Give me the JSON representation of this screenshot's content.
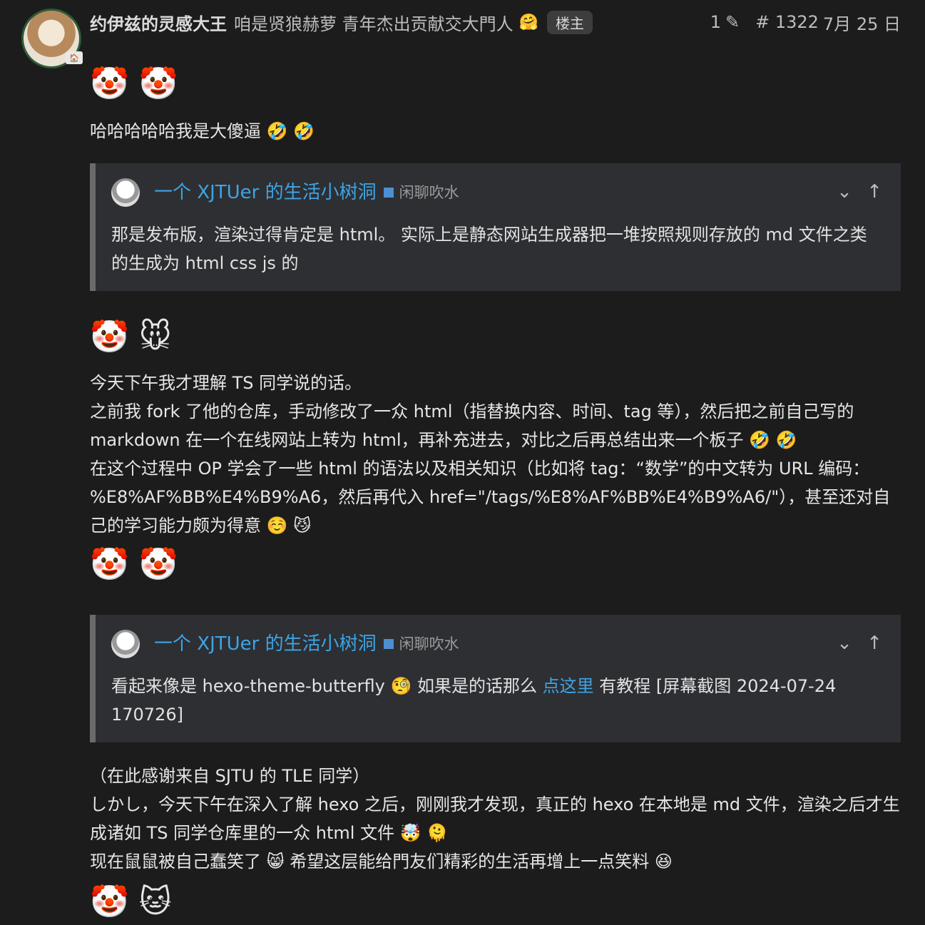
{
  "post": {
    "username": "约伊兹的灵感大王",
    "user_title": "咱是贤狼赫萝 青年杰出贡献交大門人",
    "user_emoji": "🤗",
    "op_badge": "楼主",
    "edit_count": "1",
    "edit_icon": "✎",
    "post_number": "# 1322",
    "date": "7月 25 日"
  },
  "content": {
    "emoji_row_1": "🤡 🤡",
    "line_1": "哈哈哈哈哈我是大傻逼 🤣 🤣",
    "quote_1": {
      "title": "一个 XJTUer 的生活小树洞",
      "category": "闲聊吹水",
      "body": "那是发布版，渲染过得肯定是 html。 实际上是静态网站生成器把一堆按照规则存放的 md 文件之类的生成为 html css js 的"
    },
    "emoji_row_2": "🤡 🐭",
    "paragraph_2": [
      "今天下午我才理解 TS 同学说的话。",
      "之前我 fork 了他的仓库，手动修改了一众 html（指替换内容、时间、tag 等），然后把之前自己写的 markdown 在一个在线网站上转为 html，再补充进去，对比之后再总结出来一个板子 🤣 🤣",
      "在这个过程中 OP 学会了一些 html 的语法以及相关知识（比如将 tag：“数学”的中文转为 URL 编码：%E8%AF%BB%E4%B9%A6，然后再代入 href=\"/tags/%E8%AF%BB%E4%B9%A6/\"），甚至还对自己的学习能力颇为得意 ☺️ 😼"
    ],
    "emoji_row_3": "🤡 🤡",
    "quote_2": {
      "title": "一个 XJTUer 的生活小树洞",
      "category": "闲聊吹水",
      "body_before": "看起来像是 hexo-theme-butterfly 🧐 如果是的话那么 ",
      "link": "点这里",
      "body_after": " 有教程 [屏幕截图 2024-07-24 170726]"
    },
    "paragraph_3": [
      "（在此感谢来自 SJTU 的 TLE 同学）",
      "しかし，今天下午在深入了解 hexo 之后，刚刚我才发现，真正的 hexo 在本地是 md 文件，渲染之后才生成诸如 TS 同学仓库里的一众 html 文件 🤯 🫠",
      "现在鼠鼠被自己蠢笑了 😸 希望这层能给門友们精彩的生活再增上一点笑料 😆"
    ],
    "emoji_row_4": "🤡 🐱"
  },
  "controls": {
    "collapse_icon": "⌄",
    "up_icon": "↑"
  }
}
